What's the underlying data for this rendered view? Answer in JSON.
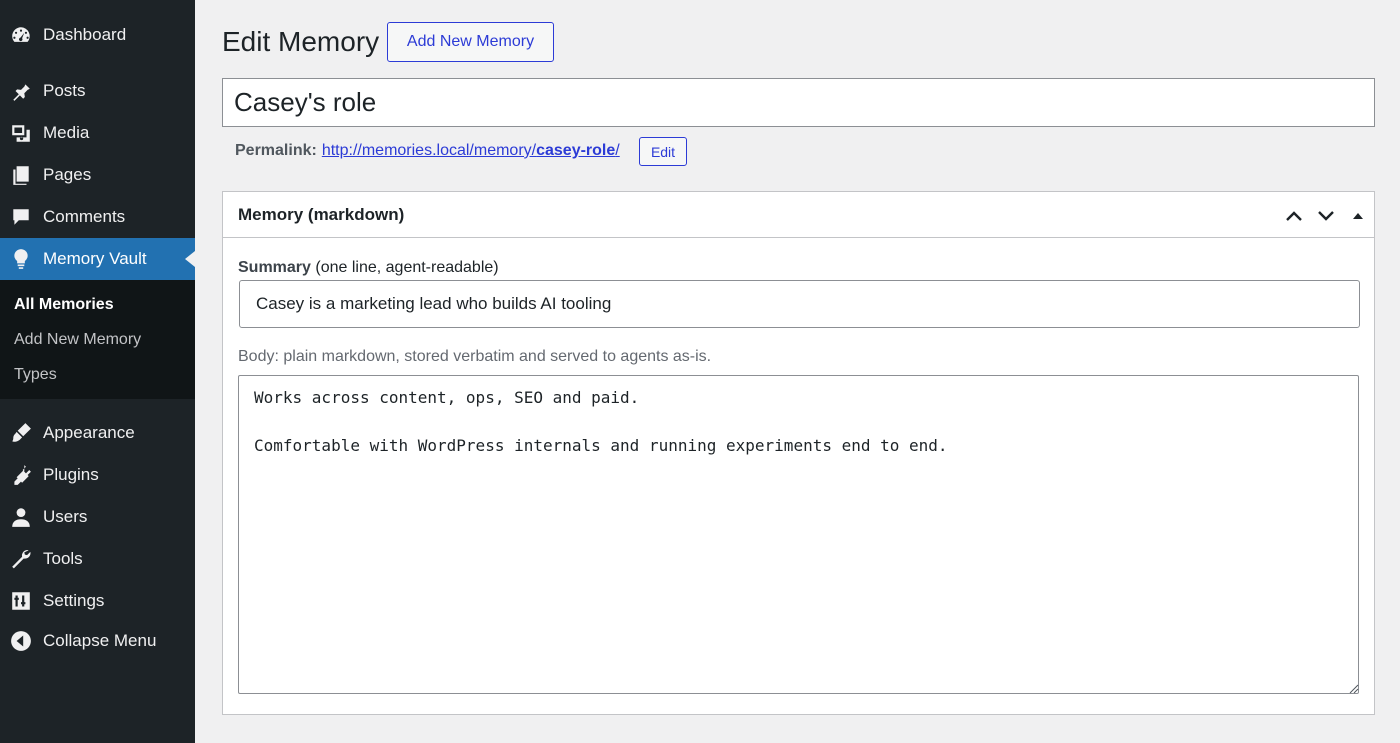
{
  "sidebar": {
    "items": [
      {
        "label": "Dashboard",
        "icon": "dashboard-icon"
      },
      {
        "label": "Posts",
        "icon": "pin-icon"
      },
      {
        "label": "Media",
        "icon": "media-icon"
      },
      {
        "label": "Pages",
        "icon": "pages-icon"
      },
      {
        "label": "Comments",
        "icon": "comment-icon"
      },
      {
        "label": "Memory Vault",
        "icon": "lightbulb-icon",
        "active": true
      },
      {
        "label": "Appearance",
        "icon": "brush-icon"
      },
      {
        "label": "Plugins",
        "icon": "plug-icon"
      },
      {
        "label": "Users",
        "icon": "user-icon"
      },
      {
        "label": "Tools",
        "icon": "wrench-icon"
      },
      {
        "label": "Settings",
        "icon": "sliders-icon"
      },
      {
        "label": "Collapse Menu",
        "icon": "collapse-icon"
      }
    ],
    "submenu": [
      {
        "label": "All Memories",
        "current": true
      },
      {
        "label": "Add New Memory"
      },
      {
        "label": "Types"
      }
    ],
    "active_color": "#2271b1"
  },
  "header": {
    "title": "Edit Memory",
    "add_new_label": "Add New Memory"
  },
  "post": {
    "title": "Casey's role",
    "permalink_label": "Permalink:",
    "permalink_base": "http://memories.local/memory/",
    "permalink_slug": "casey-role",
    "permalink_trailing": "/",
    "permalink_edit_label": "Edit"
  },
  "postbox": {
    "title": "Memory (markdown)",
    "summary_label": "Summary",
    "summary_hint": "(one line, agent-readable)",
    "summary_value": "Casey is a marketing lead who builds AI tooling",
    "body_help": "Body: plain markdown, stored verbatim and served to agents as-is.",
    "body_value": "Works across content, ops, SEO and paid.\n\nComfortable with WordPress internals and running experiments end to end."
  },
  "colors": {
    "link": "#2c3bd6",
    "sidebar_bg": "#1d2327",
    "page_bg": "#f0f0f1"
  }
}
